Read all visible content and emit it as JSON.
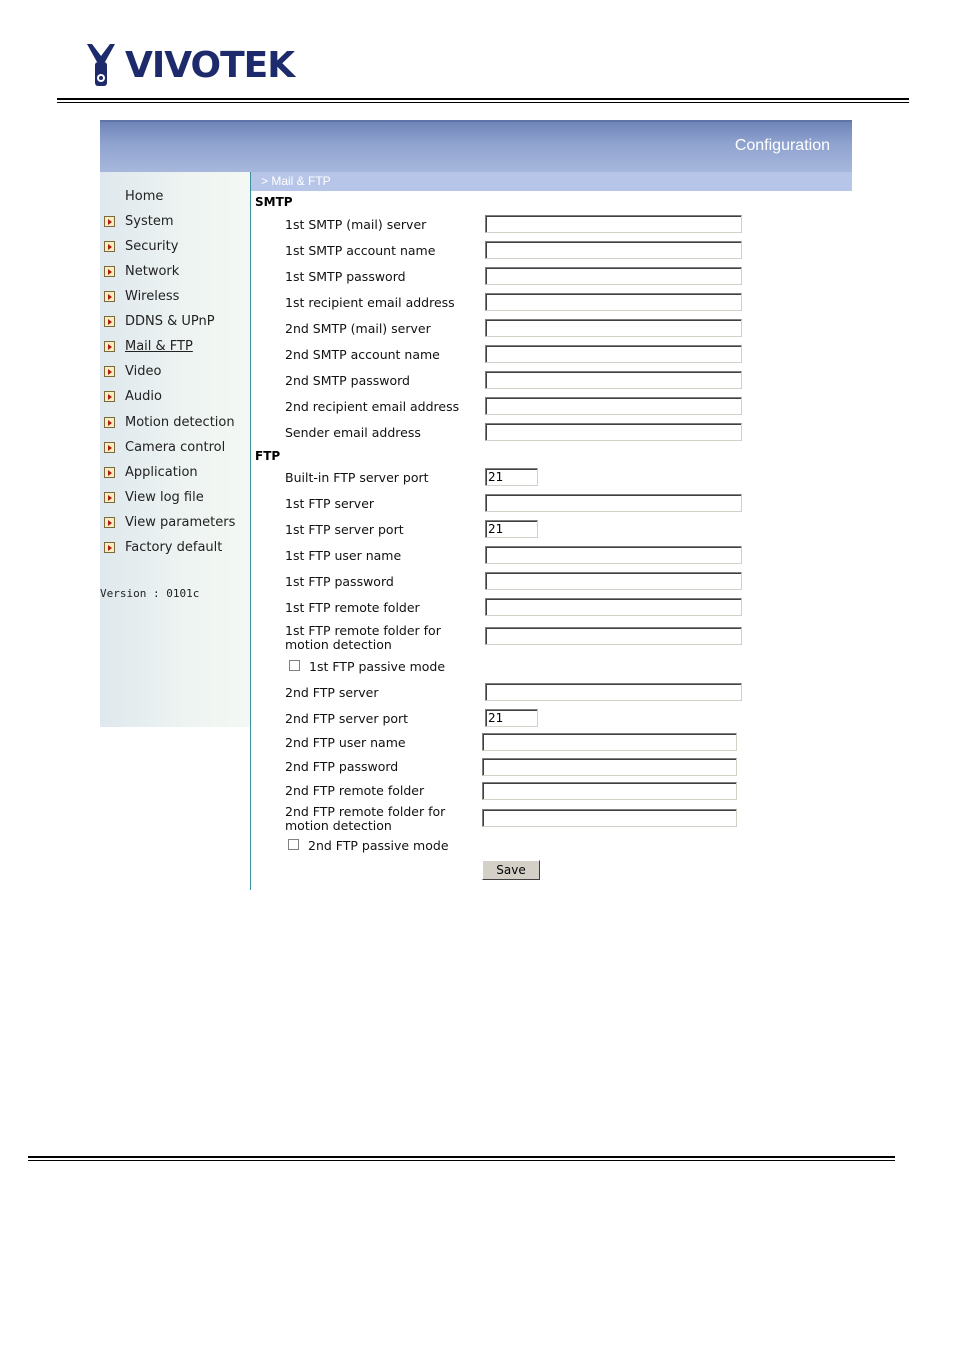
{
  "brand": {
    "name": "VIVOTEK"
  },
  "header": {
    "title": "Configuration",
    "breadcrumb": "> Mail & FTP"
  },
  "sidebar": {
    "home": "Home",
    "items": [
      {
        "label": "System"
      },
      {
        "label": "Security"
      },
      {
        "label": "Network"
      },
      {
        "label": "Wireless"
      },
      {
        "label": "DDNS & UPnP"
      },
      {
        "label": "Mail & FTP",
        "active": true
      },
      {
        "label": "Video"
      },
      {
        "label": "Audio"
      },
      {
        "label": "Motion detection"
      },
      {
        "label": "Camera control"
      },
      {
        "label": "Application"
      },
      {
        "label": "View log file"
      },
      {
        "label": "View parameters"
      },
      {
        "label": "Factory default"
      }
    ],
    "version": "Version : 0101c"
  },
  "smtp": {
    "heading": "SMTP",
    "fields": [
      {
        "label": "1st SMTP (mail) server",
        "value": ""
      },
      {
        "label": "1st SMTP account name",
        "value": ""
      },
      {
        "label": "1st SMTP password",
        "value": ""
      },
      {
        "label": "1st recipient email address",
        "value": ""
      },
      {
        "label": "2nd SMTP (mail) server",
        "value": ""
      },
      {
        "label": "2nd SMTP account name",
        "value": ""
      },
      {
        "label": "2nd SMTP password",
        "value": ""
      },
      {
        "label": "2nd recipient email address",
        "value": ""
      },
      {
        "label": "Sender email address",
        "value": ""
      }
    ]
  },
  "ftp": {
    "heading": "FTP",
    "builtin_port": {
      "label": "Built-in FTP server port",
      "value": "21"
    },
    "ftp1": {
      "server": {
        "label": "1st FTP server",
        "value": ""
      },
      "port": {
        "label": "1st FTP server port",
        "value": "21"
      },
      "user": {
        "label": "1st FTP user name",
        "value": ""
      },
      "password": {
        "label": "1st FTP password",
        "value": ""
      },
      "folder": {
        "label": "1st FTP remote folder",
        "value": ""
      },
      "motion_folder": {
        "label_line1": "1st FTP remote folder for",
        "label_line2": "motion detection",
        "value": ""
      },
      "passive": {
        "label": "1st FTP passive mode",
        "checked": false
      }
    },
    "ftp2": {
      "server": {
        "label": "2nd FTP server",
        "value": ""
      },
      "port": {
        "label": "2nd FTP server port",
        "value": "21"
      },
      "user": {
        "label": "2nd FTP user name",
        "value": ""
      },
      "password": {
        "label": "2nd FTP password",
        "value": ""
      },
      "folder": {
        "label": "2nd FTP remote folder",
        "value": ""
      },
      "motion_folder": {
        "label_line1": "2nd FTP remote folder for",
        "label_line2": "motion detection",
        "value": ""
      },
      "passive": {
        "label": "2nd FTP passive mode",
        "checked": false
      }
    }
  },
  "actions": {
    "save": "Save"
  }
}
